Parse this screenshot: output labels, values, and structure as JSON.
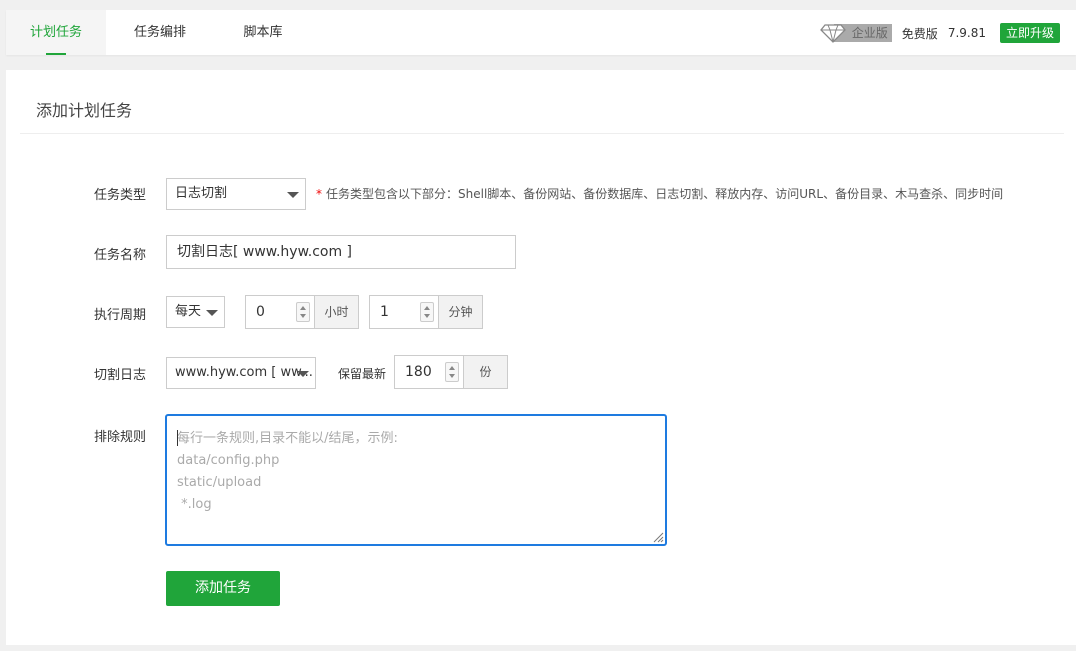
{
  "tabs": [
    {
      "label": "计划任务",
      "active": true
    },
    {
      "label": "任务编排",
      "active": false
    },
    {
      "label": "脚本库",
      "active": false
    }
  ],
  "version": {
    "edition_badge": "企业版",
    "edition": "免费版",
    "number": "7.9.81",
    "upgrade_label": "立即升级"
  },
  "panel": {
    "title": "添加计划任务"
  },
  "form": {
    "task_type": {
      "label": "任务类型",
      "value": "日志切割",
      "hint": "任务类型包含以下部分：Shell脚本、备份网站、备份数据库、日志切割、释放内存、访问URL、备份目录、木马查杀、同步时间",
      "required_mark": "*"
    },
    "task_name": {
      "label": "任务名称",
      "value": "切割日志[ www.hyw.com ]"
    },
    "cycle": {
      "label": "执行周期",
      "period": "每天",
      "hour": "0",
      "hour_unit": "小时",
      "minute": "1",
      "minute_unit": "分钟"
    },
    "cut_log": {
      "label": "切割日志",
      "site": "www.hyw.com [ ww...",
      "keep_label": "保留最新",
      "keep_value": "180",
      "keep_unit": "份"
    },
    "exclude": {
      "label": "排除规则",
      "placeholder_lines": [
        "每行一条规则,目录不能以/结尾，示例:",
        "data/config.php",
        "static/upload",
        " *.log"
      ]
    },
    "submit_label": "添加任务"
  },
  "colors": {
    "accent": "#20a53a",
    "focus_border": "#1e7be0",
    "required": "#ef0808"
  }
}
